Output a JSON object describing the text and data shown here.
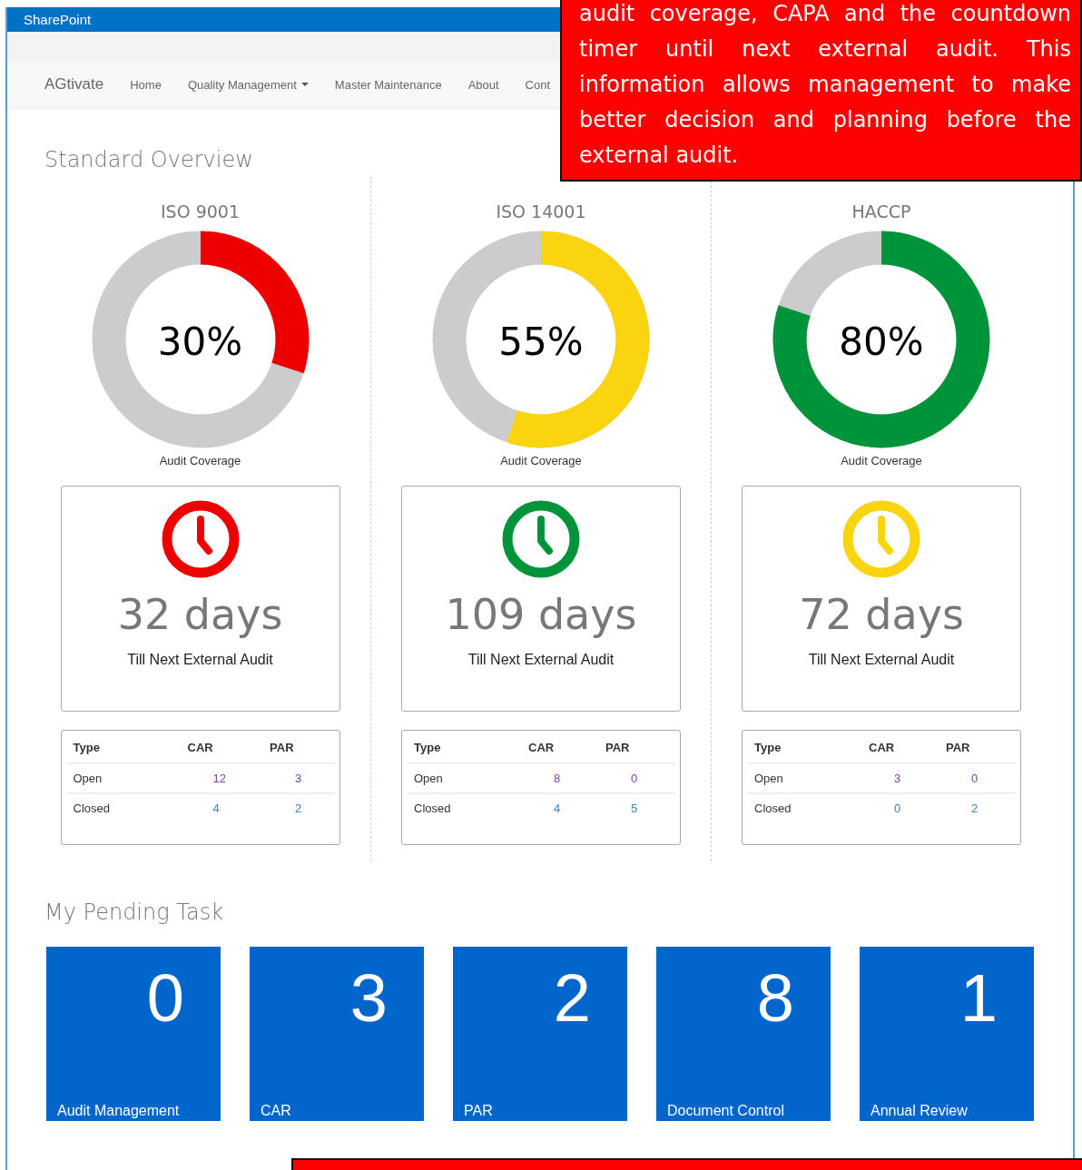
{
  "suite_bar": {
    "title": "SharePoint"
  },
  "navbar": {
    "brand": "AGtivate",
    "items": [
      {
        "label": "Home",
        "dropdown": false
      },
      {
        "label": "Quality Management",
        "dropdown": true
      },
      {
        "label": "Master Maintenance",
        "dropdown": false
      },
      {
        "label": "About",
        "dropdown": false
      },
      {
        "label": "Cont",
        "dropdown": false
      }
    ]
  },
  "overview": {
    "title": "Standard Overview",
    "standards": [
      {
        "name": "ISO 9001",
        "level": 0.3,
        "reading": "30%",
        "color": "#ee0000",
        "caption": "Audit Coverage",
        "clock": {
          "color": "#ee0000"
        },
        "days": "32 days",
        "days_caption": "Till Next External Audit",
        "table": {
          "columns": [
            "Type",
            "CAR",
            "PAR"
          ],
          "rows": [
            {
              "cells": [
                "Open",
                "12",
                "3"
              ],
              "color": "#7b3fa8"
            },
            {
              "cells": [
                "Closed",
                "4",
                "2"
              ],
              "color": "#3a82c4"
            }
          ]
        }
      },
      {
        "name": "ISO 14001",
        "level": 0.55,
        "reading": "55%",
        "color": "#f9d40f",
        "caption": "Audit Coverage",
        "clock": {
          "color": "#00943a"
        },
        "days": "109 days",
        "days_caption": "Till Next External Audit",
        "table": {
          "columns": [
            "Type",
            "CAR",
            "PAR"
          ],
          "rows": [
            {
              "cells": [
                "Open",
                "8",
                "0"
              ],
              "color": "#7b3fa8"
            },
            {
              "cells": [
                "Closed",
                "4",
                "5"
              ],
              "color": "#3a82c4"
            }
          ]
        }
      },
      {
        "name": "HACCP",
        "level": 0.8,
        "reading": "80%",
        "color": "#00943a",
        "caption": "Audit Coverage",
        "clock": {
          "color": "#f9d40f"
        },
        "days": "72 days",
        "days_caption": "Till Next External Audit",
        "table": {
          "columns": [
            "Type",
            "CAR",
            "PAR"
          ],
          "rows": [
            {
              "cells": [
                "Open",
                "3",
                "0"
              ],
              "color": "#7b3fa8"
            },
            {
              "cells": [
                "Closed",
                "0",
                "2"
              ],
              "color": "#3a82c4"
            }
          ]
        }
      }
    ]
  },
  "pending": {
    "title": "My Pending Task",
    "tiles": [
      {
        "count": "0",
        "label": "Audit Management"
      },
      {
        "count": "3",
        "label": "CAR"
      },
      {
        "count": "2",
        "label": "PAR"
      },
      {
        "count": "8",
        "label": "Document Control"
      },
      {
        "count": "1",
        "label": "Annual Review"
      }
    ]
  },
  "callout": {
    "text": "audit coverage, CAPA and the countdown timer until next external audit. This information allows management to make better decision and planning before the external audit."
  }
}
